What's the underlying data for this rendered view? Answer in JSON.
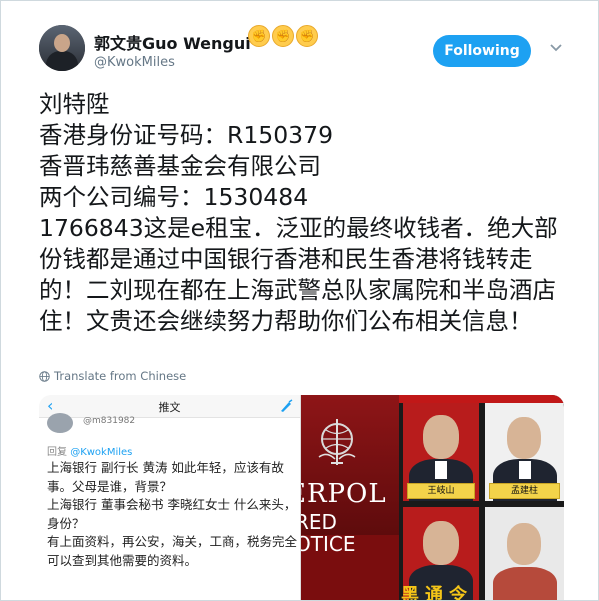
{
  "user": {
    "display_name": "郭文贵Guo Wengui",
    "handle": "@KwokMiles",
    "emoji": [
      "fist-emoji",
      "fist-emoji",
      "fist-emoji"
    ]
  },
  "actions": {
    "follow_label": "Following"
  },
  "tweet": {
    "text": "刘特陞\n香港身份证号码：R150379\n香晋玮慈善基金会有限公司\n两个公司编号：1530484\n1766843这是e租宝．泛亚的最终收钱者．绝大部份钱都是通过中国银行香港和民生香港将钱转走的！二刘现在都在上海武警总队家属院和半岛酒店住！文贵还会继续努力帮助你们公布相关信息！",
    "translate_label": "Translate from Chinese"
  },
  "media": {
    "screenshot": {
      "title": "推文",
      "back": "‹",
      "handle_partial": "@m831982",
      "reply_prefix": "回复",
      "reply_handle": "@KwokMiles",
      "text": "上海银行 副行长 黄涛 如此年轻，应该有故事。父母是谁，背景？\n上海银行 董事会秘书 李晓红女士 什么来头，身份？\n有上面资料，再公安，海关，工商，税务完全可以查到其他需要的资料。"
    },
    "poster": {
      "interpol_text": "ERPOL",
      "red_notice_text": "RED\nOTICE",
      "label_1": "王岐山",
      "label_2": "孟建柱",
      "bottom_text": "黑通令"
    }
  },
  "colors": {
    "accent": "#1da1f2",
    "text": "#14171a",
    "secondary": "#657786"
  }
}
